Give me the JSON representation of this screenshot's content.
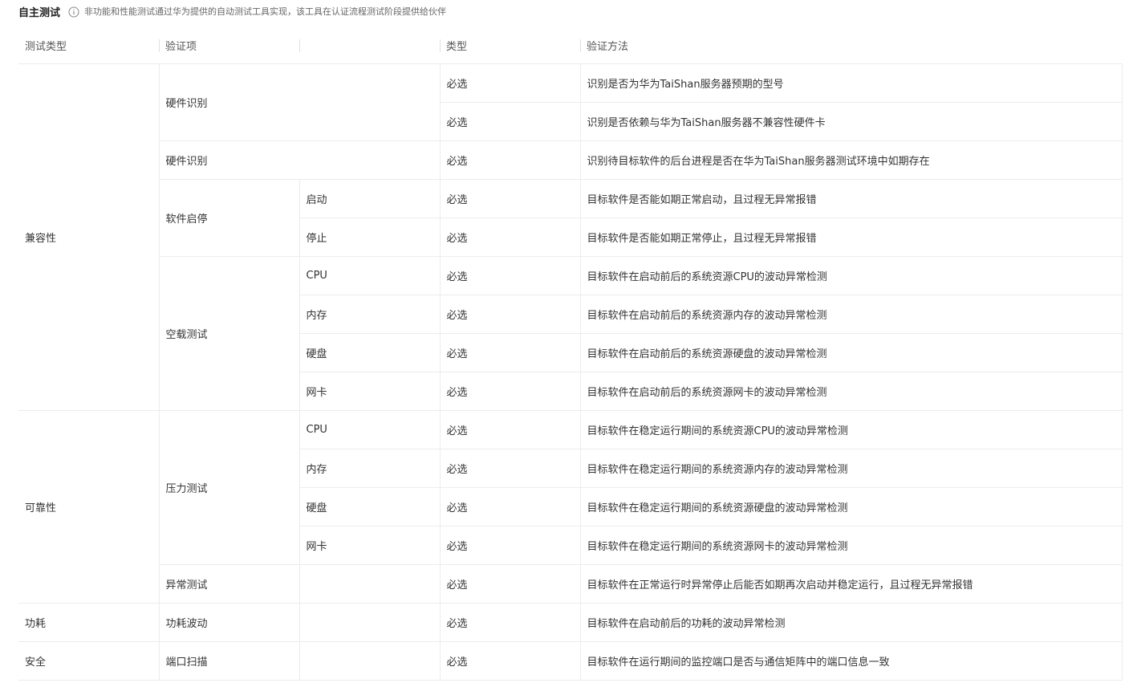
{
  "header": {
    "title": "自主测试",
    "description": "非功能和性能测试通过华为提供的自动测试工具实现，该工具在认证流程测试阶段提供给伙伴"
  },
  "table": {
    "columns": [
      "测试类型",
      "验证项",
      "",
      "类型",
      "验证方法"
    ],
    "groups": {
      "compat": "兼容性",
      "reliability": "可靠性",
      "power": "功耗",
      "security": "安全"
    },
    "items": {
      "hw_id_1": "硬件识别",
      "hw_id_2": "硬件识别",
      "sw_startstop": "软件启停",
      "idle_test": "空载测试",
      "stress_test": "压力测试",
      "exception_test": "异常测试",
      "power_fluct": "功耗波动",
      "port_scan": "端口扫描"
    },
    "sub": {
      "start": "启动",
      "stop": "停止",
      "idle_cpu": "CPU",
      "idle_mem": "内存",
      "idle_disk": "硬盘",
      "idle_nic": "网卡",
      "stress_cpu": "CPU",
      "stress_mem": "内存",
      "stress_disk": "硬盘",
      "stress_nic": "网卡"
    },
    "rows": [
      {
        "type": "必选",
        "method": "识别是否为华为TaiShan服务器预期的型号"
      },
      {
        "type": "必选",
        "method": "识别是否依赖与华为TaiShan服务器不兼容性硬件卡"
      },
      {
        "type": "必选",
        "method": "识别待目标软件的后台进程是否在华为TaiShan服务器测试环境中如期存在"
      },
      {
        "type": "必选",
        "method": "目标软件是否能如期正常启动，且过程无异常报错"
      },
      {
        "type": "必选",
        "method": "目标软件是否能如期正常停止，且过程无异常报错"
      },
      {
        "type": "必选",
        "method": "目标软件在启动前后的系统资源CPU的波动异常检测"
      },
      {
        "type": "必选",
        "method": "目标软件在启动前后的系统资源内存的波动异常检测"
      },
      {
        "type": "必选",
        "method": "目标软件在启动前后的系统资源硬盘的波动异常检测"
      },
      {
        "type": "必选",
        "method": "目标软件在启动前后的系统资源网卡的波动异常检测"
      },
      {
        "type": "必选",
        "method": "目标软件在稳定运行期间的系统资源CPU的波动异常检测"
      },
      {
        "type": "必选",
        "method": "目标软件在稳定运行期间的系统资源内存的波动异常检测"
      },
      {
        "type": "必选",
        "method": "目标软件在稳定运行期间的系统资源硬盘的波动异常检测"
      },
      {
        "type": "必选",
        "method": "目标软件在稳定运行期间的系统资源网卡的波动异常检测"
      },
      {
        "type": "必选",
        "method": "目标软件在正常运行时异常停止后能否如期再次启动并稳定运行，且过程无异常报错"
      },
      {
        "type": "必选",
        "method": "目标软件在启动前后的功耗的波动异常检测"
      },
      {
        "type": "必选",
        "method": "目标软件在运行期间的监控端口是否与通信矩阵中的端口信息一致"
      }
    ]
  },
  "icons": {
    "info": "info-circle-icon"
  }
}
